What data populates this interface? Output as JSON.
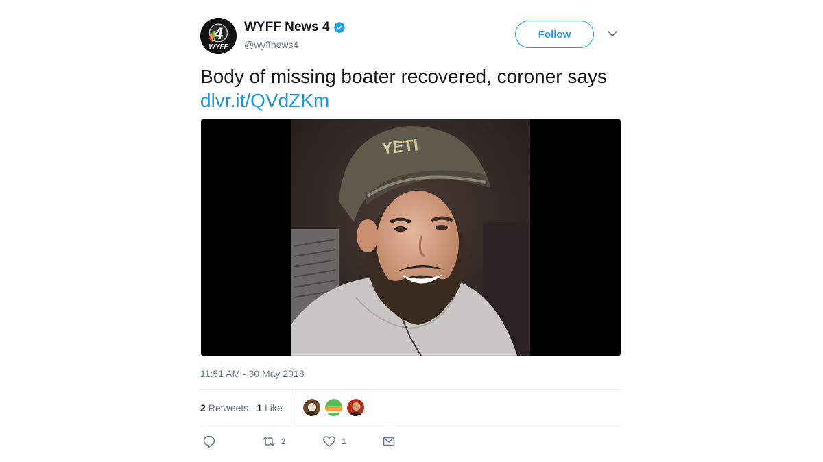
{
  "account": {
    "display_name": "WYFF News 4",
    "handle": "@wyffnews4",
    "avatar_text": "WYFF",
    "avatar_number": "4",
    "verified_icon": "verified-badge-icon"
  },
  "follow_label": "Follow",
  "tweet": {
    "text": "Body of missing boater recovered, coroner says ",
    "link": "dlvr.it/QVdZKm",
    "hat_text": "YETI",
    "timestamp": "11:51 AM - 30 May 2018"
  },
  "stats": {
    "retweets_count": "2",
    "retweets_label": "Retweets",
    "likes_count": "1",
    "likes_label": "Like"
  },
  "actions": {
    "reply_icon": "reply-icon",
    "retweet_icon": "retweet-icon",
    "retweet_count": "2",
    "like_icon": "heart-icon",
    "like_count": "1",
    "dm_icon": "envelope-icon"
  },
  "colors": {
    "link": "#1b95e0",
    "follow": "#1da1f2",
    "muted": "#657786"
  }
}
